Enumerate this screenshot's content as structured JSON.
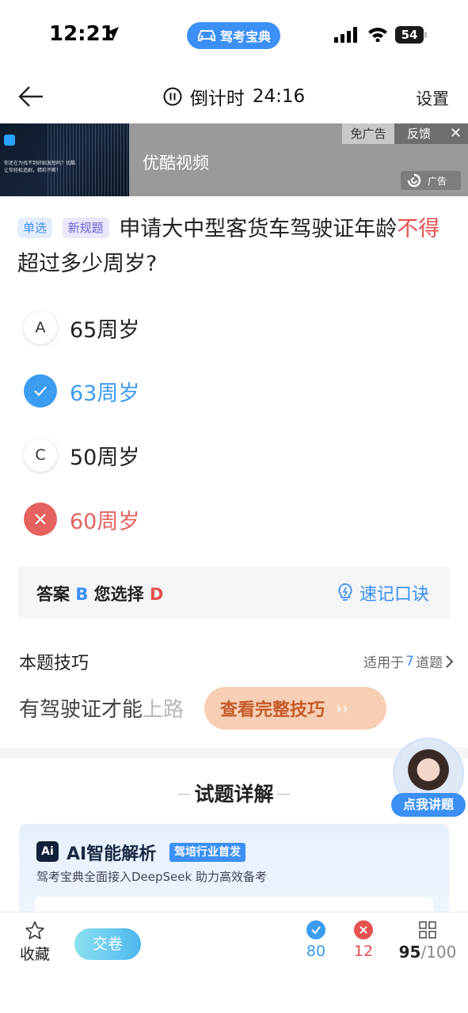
{
  "status_bar": {
    "time": "12:21",
    "app_name": "驾考宝典",
    "battery": "54"
  },
  "nav": {
    "countdown_label": "倒计时",
    "countdown_time": "24:16",
    "settings": "设置"
  },
  "ad": {
    "title": "优酷视频",
    "no_ads": "免广告",
    "feedback": "反馈",
    "close": "✕",
    "tag": "广告",
    "thumb_text": "你还在为找不到好剧发愁吗？优酷让你轻松追剧，精彩不断！"
  },
  "question": {
    "tag_type": "单选",
    "tag_rule": "新规题",
    "text_before": "申请大中型客货车驾驶证年龄",
    "text_highlight": "不得",
    "text_after": "超过多少周岁?"
  },
  "options": [
    {
      "letter": "A",
      "text": "65周岁",
      "state": "normal"
    },
    {
      "letter": "B",
      "text": "63周岁",
      "state": "correct"
    },
    {
      "letter": "C",
      "text": "50周岁",
      "state": "normal"
    },
    {
      "letter": "D",
      "text": "60周岁",
      "state": "wrong"
    }
  ],
  "answer": {
    "answer_label": "答案",
    "answer_value": "B",
    "choice_label": "您选择",
    "choice_value": "D",
    "memo_label": "速记口诀"
  },
  "tips": {
    "title": "本题技巧",
    "apply_prefix": "适用于",
    "apply_count": "7",
    "apply_suffix": "道题",
    "content_visible": "有驾驶证才能",
    "content_faded": "上路",
    "button_label": "查看完整技巧"
  },
  "detail": {
    "title": "试题详解",
    "teacher_label": "点我讲题"
  },
  "ai_card": {
    "logo": "Ai",
    "title": "AI智能解析",
    "badge": "驾培行业首发",
    "subtitle": "驾考宝典全面接入DeepSeek 助力高效备考"
  },
  "bottom": {
    "favorite": "收藏",
    "submit": "交卷",
    "correct_count": "80",
    "wrong_count": "12",
    "done": "95",
    "total": "/100"
  },
  "colors": {
    "accent_blue": "#3b8ff5",
    "correct": "#3b9cf0",
    "wrong": "#e5514f",
    "tip_button": "#f7cfb4"
  }
}
